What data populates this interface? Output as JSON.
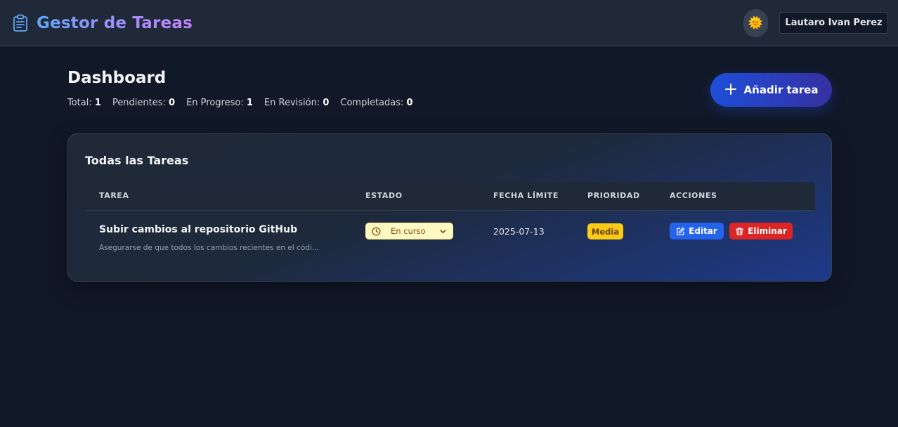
{
  "header": {
    "app_title": "Gestor de Tareas",
    "theme_icon": "sun-emoji",
    "theme_glyph": "🌞",
    "user_name": "Lautaro Ivan Perez"
  },
  "dashboard": {
    "title": "Dashboard",
    "stats": [
      {
        "label": "Total:",
        "value": "1"
      },
      {
        "label": "Pendientes:",
        "value": "0"
      },
      {
        "label": "En Progreso:",
        "value": "1"
      },
      {
        "label": "En Revisión:",
        "value": "0"
      },
      {
        "label": "Completadas:",
        "value": "0"
      }
    ],
    "add_button_label": "Añadir tarea"
  },
  "tasks_card": {
    "title": "Todas las Tareas",
    "columns": [
      "TAREA",
      "ESTADO",
      "FECHA LÍMITE",
      "PRIORIDAD",
      "ACCIONES"
    ],
    "rows": [
      {
        "title": "Subir cambios al repositorio GitHub",
        "description": "Asegurarse de que todos los cambios recientes en el códi...",
        "status": "En curso",
        "due_date": "2025-07-13",
        "priority": "Media",
        "edit_label": "Editar",
        "delete_label": "Eliminar"
      }
    ]
  },
  "colors": {
    "background": "#111827",
    "header_bg": "#1f2937",
    "accent_blue": "#2563eb",
    "danger_red": "#dc2626",
    "priority_yellow": "#facc15",
    "status_bg": "#fef9c3"
  }
}
